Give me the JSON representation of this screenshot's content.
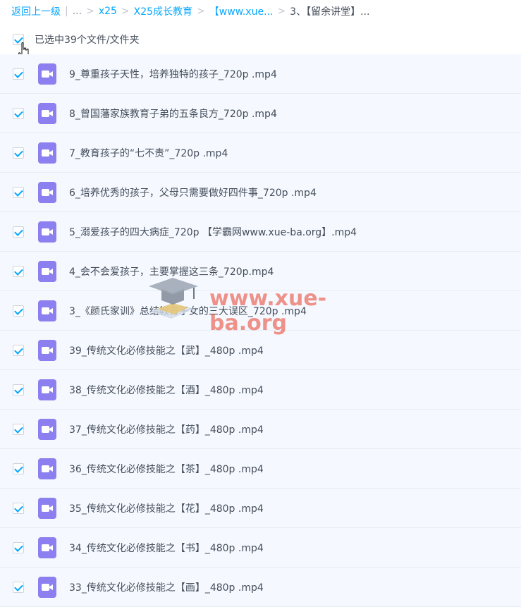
{
  "breadcrumb": {
    "back_label": "返回上一级",
    "separator_bar": "|",
    "ellipsis": "...",
    "separator": ">",
    "items": [
      "x25",
      "X25成长教育",
      "【www.xue..."
    ],
    "current": "3、【留余讲堂】..."
  },
  "selection": {
    "label": "已选中39个文件/文件夹",
    "all_checked": true
  },
  "files": [
    {
      "name": "9_尊重孩子天性，培养独特的孩子_720p .mp4",
      "checked": true
    },
    {
      "name": "8_曾国藩家族教育子弟的五条良方_720p .mp4",
      "checked": true
    },
    {
      "name": "7_教育孩子的“七不责”_720p .mp4",
      "checked": true
    },
    {
      "name": "6_培养优秀的孩子，父母只需要做好四件事_720p .mp4",
      "checked": true
    },
    {
      "name": "5_溺爱孩子的四大病症_720p 【学霸网www.xue-ba.org】.mp4",
      "checked": true
    },
    {
      "name": "4_会不会爱孩子，主要掌握这三条_720p.mp4",
      "checked": true
    },
    {
      "name": "3_《颜氏家训》总结教育子女的三大误区_720p .mp4",
      "checked": true
    },
    {
      "name": "39_传统文化必修技能之【武】_480p .mp4",
      "checked": true
    },
    {
      "name": "38_传统文化必修技能之【酒】_480p .mp4",
      "checked": true
    },
    {
      "name": "37_传统文化必修技能之【药】_480p .mp4",
      "checked": true
    },
    {
      "name": "36_传统文化必修技能之【茶】_480p .mp4",
      "checked": true
    },
    {
      "name": "35_传统文化必修技能之【花】_480p .mp4",
      "checked": true
    },
    {
      "name": "34_传统文化必修技能之【书】_480p .mp4",
      "checked": true
    },
    {
      "name": "33_传统文化必修技能之【画】_480p .mp4",
      "checked": true
    }
  ],
  "watermark": {
    "text": "www.xue-ba.org",
    "icon": "graduation-cap-icon"
  },
  "colors": {
    "accent": "#06a7ff",
    "video_icon": "#8c7ff0",
    "row_background": "#f5f9ff",
    "text": "#454d5a"
  }
}
